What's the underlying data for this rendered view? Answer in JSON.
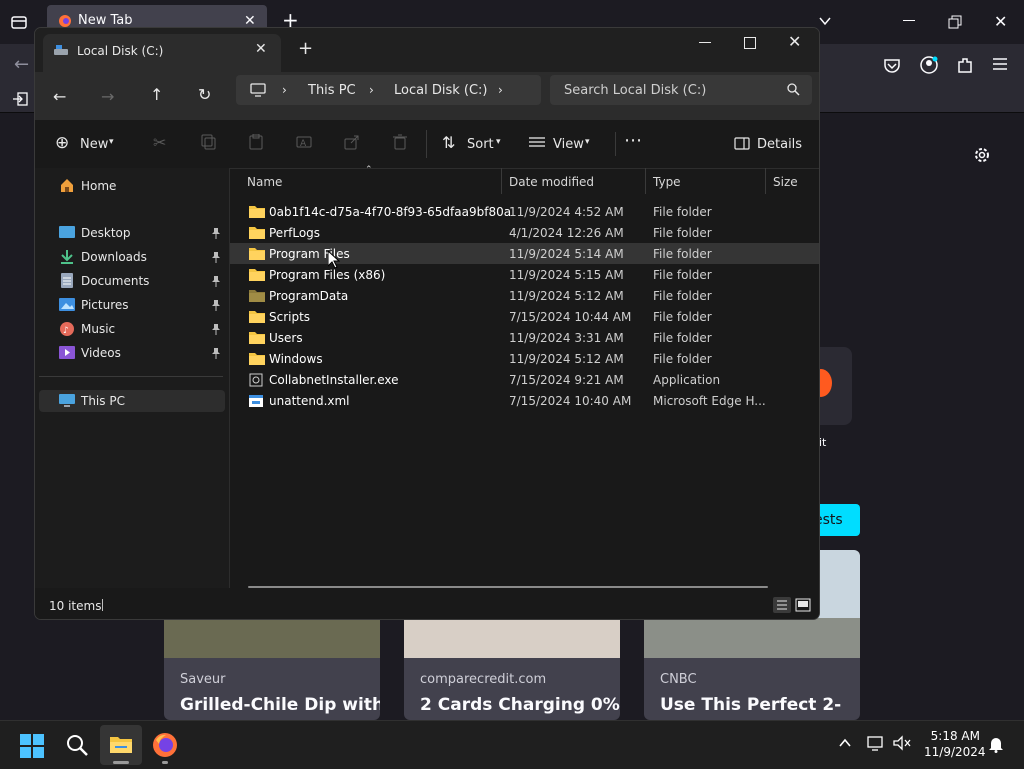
{
  "firefox": {
    "tab_title": "New Tab",
    "new_tab_symbol": "+",
    "shortcut_label_partial": "dit",
    "shortcut_number_partial": "1",
    "interests_button_partial": "ests",
    "cards": [
      {
        "source": "Saveur",
        "title": "Grilled-Chile Dip with"
      },
      {
        "source": "comparecredit.com",
        "title": "2 Cards Charging 0%"
      },
      {
        "source": "CNBC",
        "title": "Use This Perfect 2-"
      }
    ]
  },
  "explorer": {
    "tab_title": "Local Disk (C:)",
    "breadcrumb": [
      "This PC",
      "Local Disk (C:)"
    ],
    "search_placeholder": "Search Local Disk (C:)",
    "toolbar": {
      "new_label": "New",
      "sort_label": "Sort",
      "view_label": "View",
      "details_label": "Details"
    },
    "nav": {
      "home": "Home",
      "quick_access": [
        {
          "label": "Desktop",
          "icon": "desktop-icon",
          "color": "#4aa3df"
        },
        {
          "label": "Downloads",
          "icon": "download-icon",
          "color": "#4ec28a"
        },
        {
          "label": "Documents",
          "icon": "documents-icon",
          "color": "#9aa8bd"
        },
        {
          "label": "Pictures",
          "icon": "pictures-icon",
          "color": "#3d8fe0"
        },
        {
          "label": "Music",
          "icon": "music-icon",
          "color": "#e46a5a"
        },
        {
          "label": "Videos",
          "icon": "videos-icon",
          "color": "#8a55d6"
        }
      ],
      "this_pc": "This PC"
    },
    "columns": {
      "name": "Name",
      "date": "Date modified",
      "type": "Type",
      "size": "Size"
    },
    "files": [
      {
        "name": "0ab1f14c-d75a-4f70-8f93-65dfaa9bf80a",
        "date": "11/9/2024 4:52 AM",
        "type": "File folder",
        "icon": "folder-icon"
      },
      {
        "name": "PerfLogs",
        "date": "4/1/2024 12:26 AM",
        "type": "File folder",
        "icon": "folder-icon"
      },
      {
        "name": "Program Files",
        "date": "11/9/2024 5:14 AM",
        "type": "File folder",
        "icon": "folder-icon",
        "hovered": true
      },
      {
        "name": "Program Files (x86)",
        "date": "11/9/2024 5:15 AM",
        "type": "File folder",
        "icon": "folder-icon"
      },
      {
        "name": "ProgramData",
        "date": "11/9/2024 5:12 AM",
        "type": "File folder",
        "icon": "folder-dim-icon"
      },
      {
        "name": "Scripts",
        "date": "7/15/2024 10:44 AM",
        "type": "File folder",
        "icon": "folder-icon"
      },
      {
        "name": "Users",
        "date": "11/9/2024 3:31 AM",
        "type": "File folder",
        "icon": "folder-icon"
      },
      {
        "name": "Windows",
        "date": "11/9/2024 5:12 AM",
        "type": "File folder",
        "icon": "folder-icon"
      },
      {
        "name": "CollabnetInstaller.exe",
        "date": "7/15/2024 9:21 AM",
        "type": "Application",
        "icon": "exe-icon"
      },
      {
        "name": "unattend.xml",
        "date": "7/15/2024 10:40 AM",
        "type": "Microsoft Edge H...",
        "icon": "xml-icon"
      }
    ],
    "status_text": "10 items"
  },
  "taskbar": {
    "time": "5:18 AM",
    "date": "11/9/2024"
  },
  "colors": {
    "folder": "#f4c542",
    "accent_selected": "#2d2d2d",
    "hover_row": "#353535",
    "card_bg": "#42414d",
    "interest_button": "#00ddff"
  }
}
